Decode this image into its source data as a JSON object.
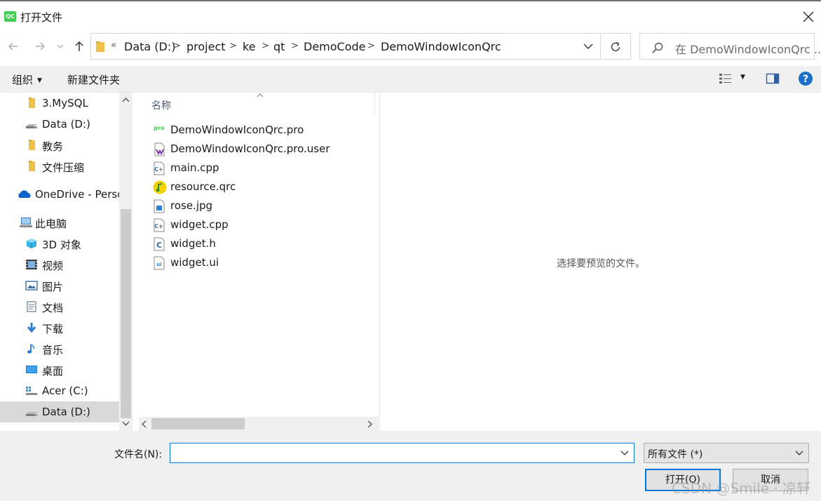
{
  "window": {
    "title": "打开文件",
    "app_icon_text": "QC"
  },
  "address": {
    "overflow_label": "«",
    "breadcrumbs": [
      "Data (D:)",
      "project",
      "ke",
      "qt",
      "DemoCode",
      "DemoWindowIconQrc"
    ],
    "separator": ">"
  },
  "search": {
    "placeholder": "在 DemoWindowIconQrc ..."
  },
  "toolbar": {
    "organize_label": "组织",
    "new_folder_label": "新建文件夹"
  },
  "nav": {
    "items": [
      {
        "label": "3.MySQL",
        "icon": "folder-icon"
      },
      {
        "label": "Data (D:)",
        "icon": "drive-icon"
      },
      {
        "label": "教务",
        "icon": "folder-icon"
      },
      {
        "label": "文件压缩",
        "icon": "folder-icon"
      },
      {
        "label": "OneDrive - Perso",
        "icon": "onedrive-icon"
      },
      {
        "label": "此电脑",
        "icon": "computer-icon"
      },
      {
        "label": "3D 对象",
        "icon": "3d-objects-icon"
      },
      {
        "label": "视频",
        "icon": "video-icon"
      },
      {
        "label": "图片",
        "icon": "pictures-icon"
      },
      {
        "label": "文档",
        "icon": "documents-icon"
      },
      {
        "label": "下载",
        "icon": "download-icon"
      },
      {
        "label": "音乐",
        "icon": "music-icon"
      },
      {
        "label": "桌面",
        "icon": "desktop-icon"
      },
      {
        "label": "Acer (C:)",
        "icon": "system-drive-icon"
      },
      {
        "label": "Data (D:)",
        "icon": "drive-icon",
        "selected": true
      }
    ]
  },
  "files": {
    "column_name": "名称",
    "items": [
      {
        "name": "DemoWindowIconQrc.pro",
        "icon": "pro-file-icon"
      },
      {
        "name": "DemoWindowIconQrc.pro.user",
        "icon": "user-file-icon"
      },
      {
        "name": "main.cpp",
        "icon": "cpp-file-icon"
      },
      {
        "name": "resource.qrc",
        "icon": "qrc-file-icon"
      },
      {
        "name": "rose.jpg",
        "icon": "image-file-icon"
      },
      {
        "name": "widget.cpp",
        "icon": "cpp-file-icon"
      },
      {
        "name": "widget.h",
        "icon": "header-file-icon"
      },
      {
        "name": "widget.ui",
        "icon": "ui-file-icon"
      }
    ]
  },
  "preview": {
    "message": "选择要预览的文件。"
  },
  "footer": {
    "filename_label": "文件名(N):",
    "filename_value": "",
    "filetype_value": "所有文件 (*)",
    "open_label": "打开(O)",
    "cancel_label": "取消"
  },
  "watermark": "CSDN @Smile · 凉轩",
  "colors": {
    "accent": "#0078d7",
    "folder": "#f0c048",
    "qt_green": "#41cd52"
  }
}
